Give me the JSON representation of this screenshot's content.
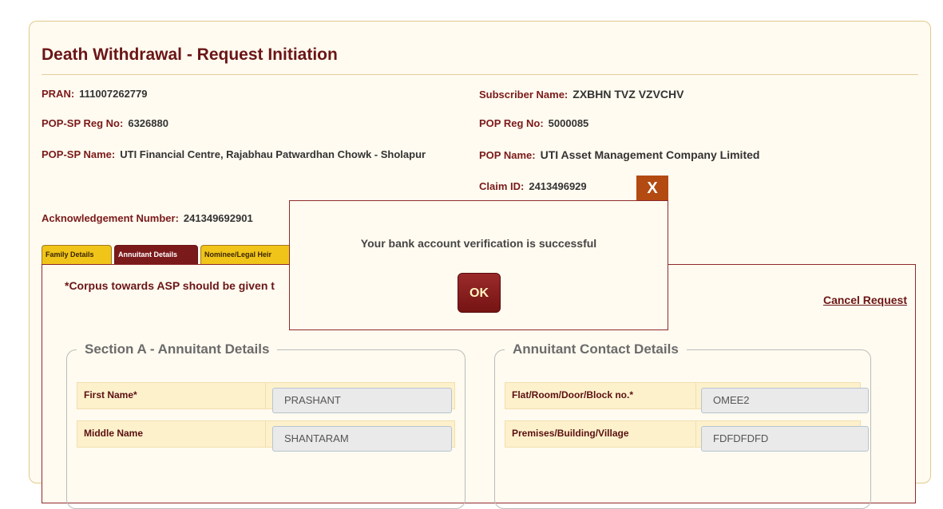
{
  "title": "Death Withdrawal - Request Initiation",
  "info": {
    "pran_label": "PRAN:",
    "pran_value": "111007262779",
    "subscriber_label": "Subscriber Name:",
    "subscriber_value": "ZXBHN TVZ VZVCHV",
    "popsp_reg_label": "POP-SP Reg No:",
    "popsp_reg_value": "6326880",
    "pop_reg_label": "POP Reg No:",
    "pop_reg_value": "5000085",
    "popsp_name_label": "POP-SP Name:",
    "popsp_name_value": "UTI Financial Centre, Rajabhau Patwardhan Chowk - Sholapur",
    "pop_name_label": "POP Name:",
    "pop_name_value": "UTI Asset Management Company Limited",
    "claim_label": "Claim ID:",
    "claim_value": "2413496929",
    "ack_label": "Acknowledgement Number:",
    "ack_value": "241349692901"
  },
  "tabs": [
    {
      "label": "Family Details"
    },
    {
      "label": "Annuitant Details"
    },
    {
      "label": "Nominee/Legal Heir"
    }
  ],
  "note": "*Corpus towards ASP should be given t",
  "cancel_label": "Cancel Request",
  "section_a": {
    "legend": "Section A - Annuitant Details",
    "rows": [
      {
        "label": "First Name*",
        "value": "PRASHANT"
      },
      {
        "label": "Middle Name",
        "value": "SHANTARAM"
      }
    ]
  },
  "contact": {
    "legend": "Annuitant Contact Details",
    "rows": [
      {
        "label": "Flat/Room/Door/Block no.*",
        "value": "OMEE2"
      },
      {
        "label": "Premises/Building/Village",
        "value": "FDFDFDFD"
      }
    ]
  },
  "dialog": {
    "close_label": "X",
    "message": "Your bank account verification is successful",
    "ok_label": "OK"
  }
}
